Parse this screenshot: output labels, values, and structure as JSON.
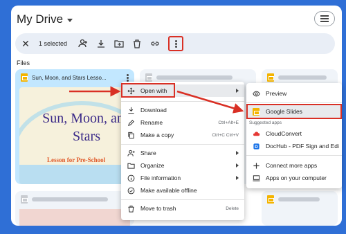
{
  "header": {
    "title": "My Drive"
  },
  "selection_bar": {
    "count_label": "1 selected"
  },
  "files_label": "Files",
  "cards": {
    "selected": {
      "name": "Sun, Moon, and Stars Lesso...",
      "thumb_title": "Sun, Moon, and Stars",
      "thumb_subtitle": "Lesson for Pre-School"
    }
  },
  "context_menu": {
    "open_with": "Open with",
    "download": "Download",
    "rename": "Rename",
    "rename_shortcut": "Ctrl+Alt+E",
    "make_copy": "Make a copy",
    "make_copy_shortcut": "Ctrl+C Ctrl+V",
    "share": "Share",
    "organize": "Organize",
    "file_information": "File information",
    "make_offline": "Make available offline",
    "move_trash": "Move to trash",
    "move_trash_shortcut": "Delete"
  },
  "open_with_menu": {
    "preview": "Preview",
    "google_slides": "Google Slides",
    "suggested_apps": "Suggested apps",
    "cloudconvert": "CloudConvert",
    "dochub": "DocHub - PDF Sign and Edi",
    "connect_more": "Connect more apps",
    "apps_on_computer": "Apps on your computer"
  },
  "colors": {
    "background": "#2f6fd6",
    "highlight": "#d93025",
    "slides": "#f4b400"
  }
}
